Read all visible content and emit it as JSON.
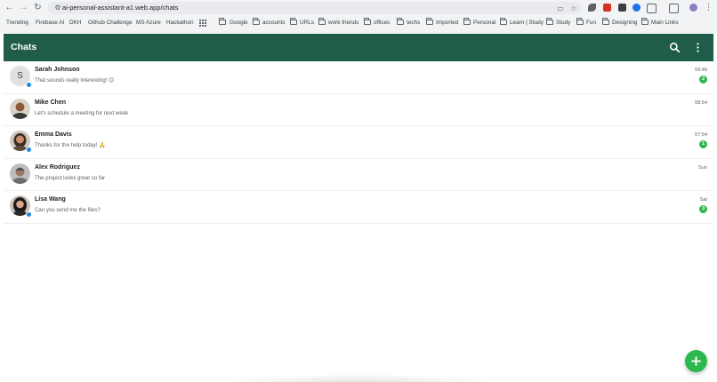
{
  "browser": {
    "url": "ai-personal-assistant-a1.web.app/chats",
    "bookmarks": [
      "Trending",
      "Firebase AI",
      "DKH",
      "Github Challenge",
      "MS Azure",
      "Hackathon"
    ],
    "folders": [
      "Google",
      "accounts",
      "URLs",
      "work friends",
      "offices",
      "techs",
      "Imported",
      "Personal",
      "Learn | Study",
      "Study",
      "Fun",
      "Designing",
      "Main Links"
    ]
  },
  "app": {
    "title": "Chats",
    "colors": {
      "header": "#1f5c4a",
      "accent": "#2db84d",
      "online": "#1e88e5"
    }
  },
  "chats": [
    {
      "name": "Sarah Johnson",
      "message": "That sounds really interesting! 😊",
      "time": "09:49",
      "unread": "2",
      "avatar_letter": "S",
      "online": true
    },
    {
      "name": "Mike Chen",
      "message": "Let's schedule a meeting for next week",
      "time": "08:54",
      "unread": "",
      "avatar_letter": "",
      "online": false
    },
    {
      "name": "Emma Davis",
      "message": "Thanks for the help today! 🙏",
      "time": "07:54",
      "unread": "1",
      "avatar_letter": "",
      "online": true
    },
    {
      "name": "Alex Rodriguez",
      "message": "The project looks great so far",
      "time": "Sun",
      "unread": "",
      "avatar_letter": "",
      "online": false
    },
    {
      "name": "Lisa Wang",
      "message": "Can you send me the files?",
      "time": "Sat",
      "unread": "3",
      "avatar_letter": "",
      "online": true
    }
  ]
}
